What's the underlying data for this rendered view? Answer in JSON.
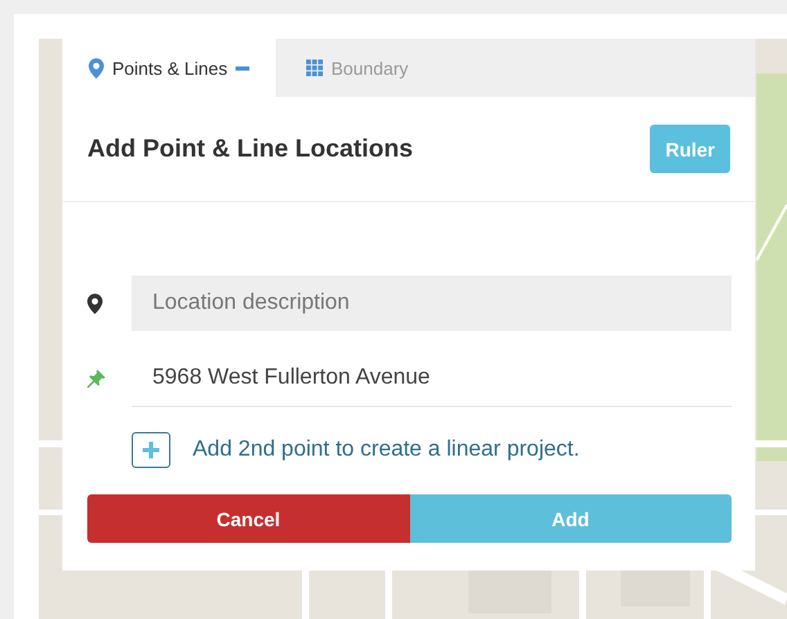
{
  "tabs": [
    {
      "label": "Points & Lines",
      "selected": true
    },
    {
      "label": "Boundary",
      "selected": false
    }
  ],
  "header": {
    "title": "Add Point & Line Locations",
    "button": "Ruler"
  },
  "fields": [
    {
      "kind": "input",
      "placeholder": "Location description"
    },
    {
      "kind": "value",
      "value": "5968 West Fullerton Avenue"
    }
  ],
  "add_point": {
    "label": "Add 2nd point to create a linear project."
  },
  "buttons": [
    {
      "label": "Cancel",
      "kind": "danger"
    },
    {
      "label": "Add",
      "kind": "primary"
    }
  ]
}
